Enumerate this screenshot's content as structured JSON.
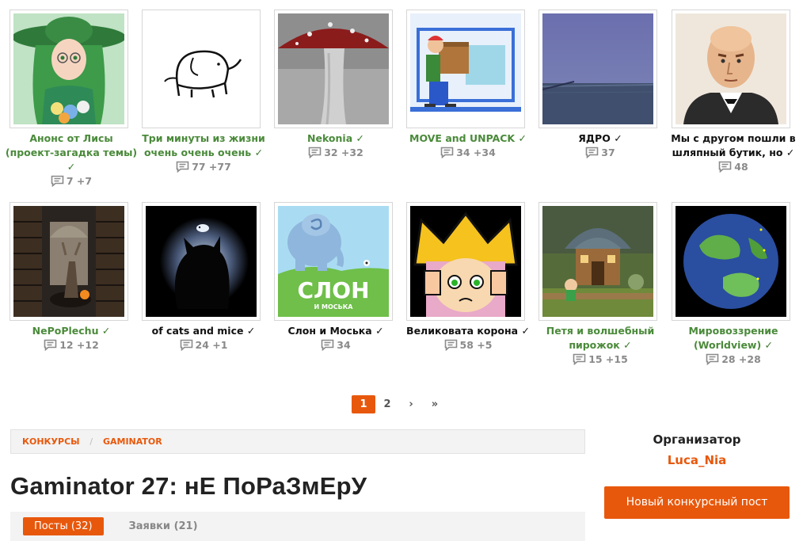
{
  "games": [
    {
      "title": "Анонс от Лисы (проект-загадка темы)",
      "checked": true,
      "comments": "7 +7",
      "title_color": "green",
      "thumb": "anime-girl"
    },
    {
      "title": "Три минуты из жизни очень очень очень",
      "checked": true,
      "comments": "77 +77",
      "title_color": "green",
      "thumb": "elephant-sketch"
    },
    {
      "title": "Nekonia",
      "checked": true,
      "comments": "32 +32",
      "title_color": "green",
      "thumb": "mushroom"
    },
    {
      "title": "MOVE and UNPACK",
      "checked": true,
      "comments": "34 +34",
      "title_color": "green",
      "thumb": "mover"
    },
    {
      "title": "ЯДРО",
      "checked": true,
      "comments": "37",
      "title_color": "dark",
      "thumb": "sea"
    },
    {
      "title": "Мы с другом пошли в шляпный бутик, но",
      "checked": true,
      "comments": "48",
      "title_color": "dark",
      "thumb": "bald-man"
    },
    {
      "title": "NePoPlechu",
      "checked": true,
      "comments": "12 +12",
      "title_color": "green",
      "thumb": "library"
    },
    {
      "title": "of cats and mice",
      "checked": true,
      "comments": "24 +1",
      "title_color": "dark",
      "thumb": "cat-silhouette"
    },
    {
      "title": "Слон и Моська",
      "checked": true,
      "comments": "34",
      "title_color": "dark",
      "thumb": "blue-elephant"
    },
    {
      "title": "Великовата корона",
      "checked": true,
      "comments": "58 +5",
      "title_color": "dark",
      "thumb": "crown"
    },
    {
      "title": "Петя и волшебный пирожок",
      "checked": true,
      "comments": "15 +15",
      "title_color": "green",
      "thumb": "mushroom-house"
    },
    {
      "title": "Мировоззрение (Worldview)",
      "checked": true,
      "comments": "28 +28",
      "title_color": "green",
      "thumb": "planet"
    }
  ],
  "thumb_text": {
    "slon": "СЛОН",
    "moska": "И МОСЬКА"
  },
  "check_mark": "✓",
  "comment_icon": "speech-bubble-icon",
  "pagination": {
    "pages": [
      "1",
      "2"
    ],
    "current": "1",
    "next": "›",
    "last": "»"
  },
  "breadcrumb": {
    "items": [
      "Конкурсы",
      "Gaminator"
    ],
    "separator": "/"
  },
  "page_title": "Gaminator 27: нЕ ПоРаЗмЕрУ",
  "tabs": [
    {
      "label": "Посты (32)",
      "active": true
    },
    {
      "label": "Заявки (21)",
      "active": false
    }
  ],
  "organizer": {
    "label": "Организатор",
    "name": "Luca_Nia"
  },
  "new_post_button": "Новый конкурсный пост",
  "colors": {
    "accent": "#e8580c",
    "green_title": "#4a8a3a",
    "muted": "#8a8a8a"
  }
}
